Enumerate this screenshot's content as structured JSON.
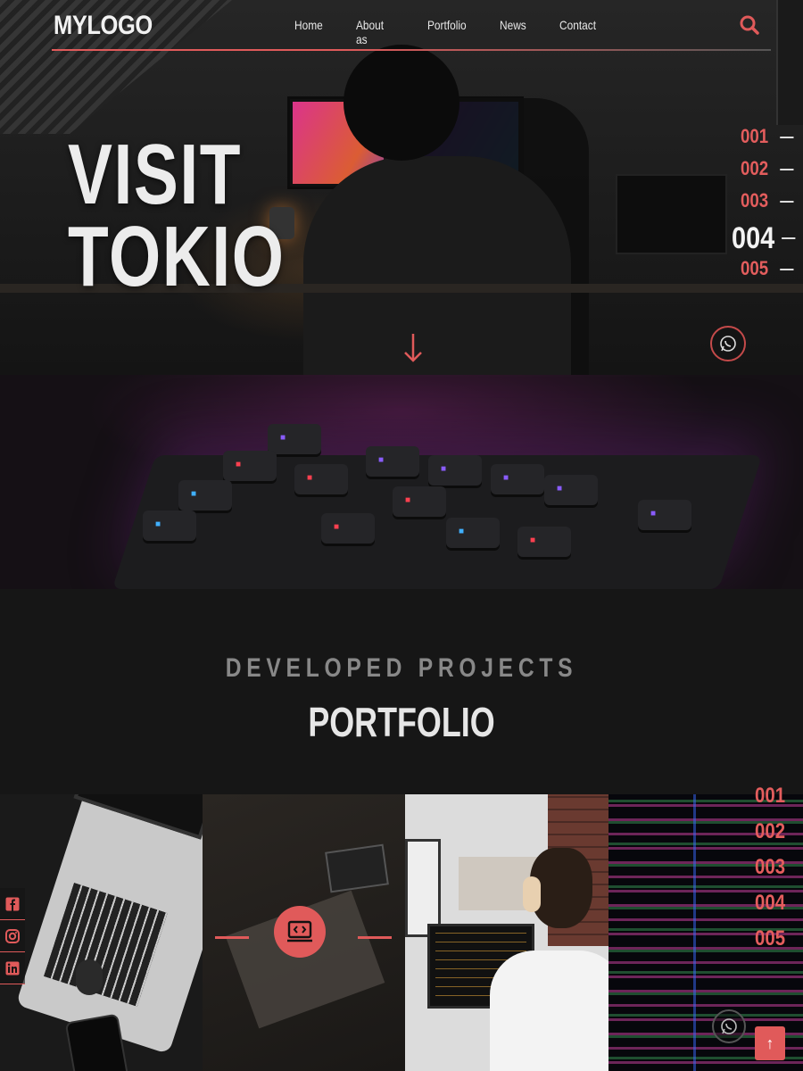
{
  "header": {
    "logo": "MYLOGO",
    "nav": [
      "Home",
      "About as",
      "Portfolio",
      "News",
      "Contact"
    ],
    "search_icon": "search-icon"
  },
  "hero": {
    "title_line1": "VISIT",
    "title_line2": "TOKIO",
    "slides": [
      "001",
      "002",
      "003",
      "004",
      "005"
    ],
    "active_slide": "004",
    "scroll_icon": "arrow-down-icon",
    "whatsapp_icon": "whatsapp-icon"
  },
  "portfolio": {
    "subtitle": "DEVELOPED PROJECTS",
    "title": "PORTFOLIO",
    "tile_icon": "code-laptop-icon",
    "slides": [
      "001",
      "002",
      "003",
      "004",
      "005"
    ]
  },
  "social": [
    "facebook-icon",
    "instagram-icon",
    "linkedin-icon"
  ],
  "back_to_top": "↑",
  "colors": {
    "accent": "#e05a5a",
    "background": "#141414",
    "text": "#ececec",
    "muted": "#888888"
  }
}
